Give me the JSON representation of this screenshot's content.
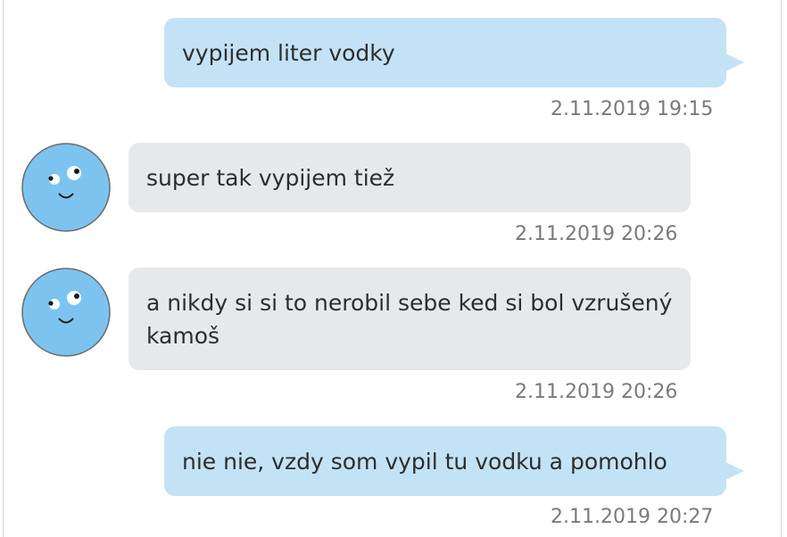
{
  "conversation": {
    "messages": [
      {
        "direction": "outgoing",
        "text": "vypijem liter vodky",
        "timestamp": "2.11.2019 19:15"
      },
      {
        "direction": "incoming",
        "text": "super tak vypijem tiež",
        "timestamp": "2.11.2019 20:26",
        "avatar": "smiley-face-avatar"
      },
      {
        "direction": "incoming",
        "text": "a nikdy si si to nerobil sebe ked si bol vzrušený kamoš",
        "timestamp": "2.11.2019 20:26",
        "avatar": "smiley-face-avatar"
      },
      {
        "direction": "outgoing",
        "text": "nie nie, vzdy som vypil tu vodku a pomohlo",
        "timestamp": "2.11.2019 20:27"
      }
    ]
  },
  "colors": {
    "outgoing_bubble": "#c4e2f6",
    "incoming_bubble": "#e6e8eb",
    "avatar_fill": "#7cc4ef",
    "timestamp_text": "#7a7a7a",
    "message_text": "#2d2d2d"
  }
}
